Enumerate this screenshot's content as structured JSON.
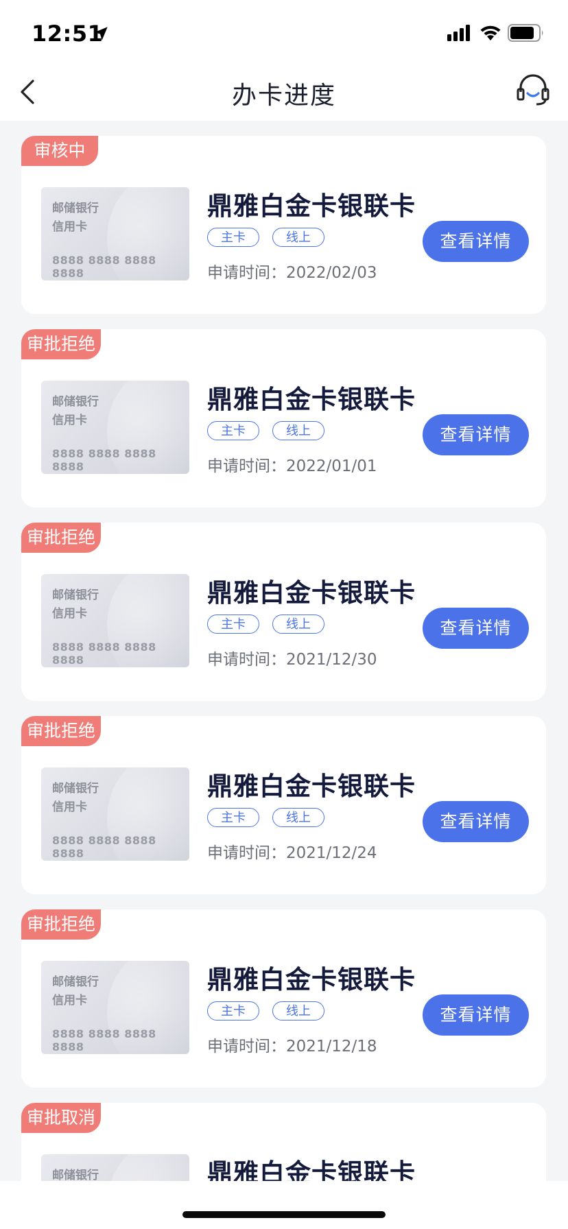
{
  "status_bar": {
    "time": "12:51",
    "icons": [
      "location-arrow-icon",
      "signal-icon",
      "wifi-icon",
      "battery-icon"
    ]
  },
  "nav": {
    "title": "办卡进度",
    "back_icon": "chevron-left-icon",
    "service_icon": "customer-service-headset-icon"
  },
  "colors": {
    "status_tag": "#ef7c77",
    "accent": "#4c72ea",
    "tag_border": "#4a73e8"
  },
  "applications": [
    {
      "status": "审核中",
      "card_image": {
        "bank": "邮储银行",
        "type": "信用卡",
        "number": "8888 8888 8888 8888"
      },
      "card_name": "鼎雅白金卡银联卡",
      "tags": [
        "主卡",
        "线上"
      ],
      "apply_time": "申请时间：2022/02/03",
      "button": "查看详情"
    },
    {
      "status": "审批拒绝",
      "card_image": {
        "bank": "邮储银行",
        "type": "信用卡",
        "number": "8888 8888 8888 8888"
      },
      "card_name": "鼎雅白金卡银联卡",
      "tags": [
        "主卡",
        "线上"
      ],
      "apply_time": "申请时间：2022/01/01",
      "button": "查看详情"
    },
    {
      "status": "审批拒绝",
      "card_image": {
        "bank": "邮储银行",
        "type": "信用卡",
        "number": "8888 8888 8888 8888"
      },
      "card_name": "鼎雅白金卡银联卡",
      "tags": [
        "主卡",
        "线上"
      ],
      "apply_time": "申请时间：2021/12/30",
      "button": "查看详情"
    },
    {
      "status": "审批拒绝",
      "card_image": {
        "bank": "邮储银行",
        "type": "信用卡",
        "number": "8888 8888 8888 8888"
      },
      "card_name": "鼎雅白金卡银联卡",
      "tags": [
        "主卡",
        "线上"
      ],
      "apply_time": "申请时间：2021/12/24",
      "button": "查看详情"
    },
    {
      "status": "审批拒绝",
      "card_image": {
        "bank": "邮储银行",
        "type": "信用卡",
        "number": "8888 8888 8888 8888"
      },
      "card_name": "鼎雅白金卡银联卡",
      "tags": [
        "主卡",
        "线上"
      ],
      "apply_time": "申请时间：2021/12/18",
      "button": "查看详情"
    },
    {
      "status": "审批取消",
      "card_image": {
        "bank": "邮储银行"
      },
      "card_name": "鼎雅白金卡银联卡"
    }
  ]
}
